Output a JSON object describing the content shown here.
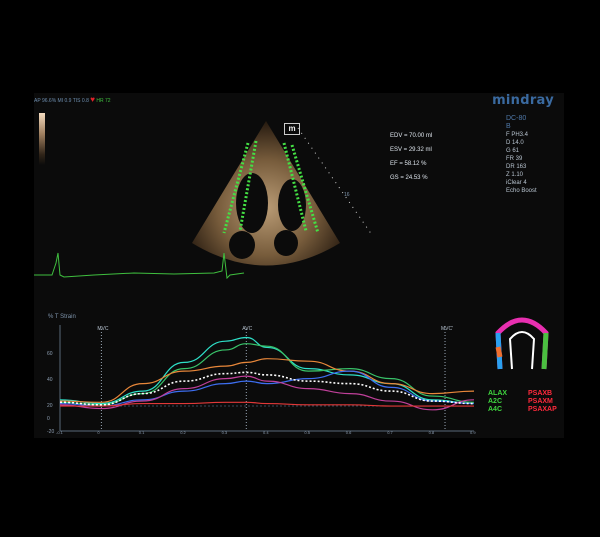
{
  "status_bar": {
    "prefix": "AP 96.6%  MI 0.9 TIS 0.8",
    "hr": "HR 72",
    "heart_icon": "heart-icon"
  },
  "brand": "mindray",
  "params": {
    "model": "DC-80",
    "mode": "B",
    "lines": [
      "F PH3.4",
      "D 14.0",
      "G 61",
      "FR 39",
      "DR 163",
      "Z 1.10",
      "iClear 4",
      "Echo Boost"
    ]
  },
  "metrics": {
    "edv": "EDV = 70.00 ml",
    "esv": "ESV = 29.32 ml",
    "ef": "EF = 58.12 %",
    "gs": "GS = 24.53 %"
  },
  "depth_mark": "16",
  "chart_data": {
    "type": "line",
    "title": "% T Strain",
    "y_ticks": [
      "60",
      "40",
      "20",
      "0",
      "-20"
    ],
    "ylim": [
      -20,
      65
    ],
    "x_ticks": [
      "-0.1",
      "0",
      "0.1",
      "0.2",
      "0.3",
      "0.4",
      "0.5",
      "0.6",
      "0.7",
      "0.8",
      "0.9"
    ],
    "xlim": [
      -0.1,
      0.9
    ],
    "events": [
      {
        "label": "MVC",
        "x": 0.0
      },
      {
        "label": "AVC",
        "x": 0.35
      },
      {
        "label": "MVC'",
        "x": 0.83
      }
    ],
    "series": [
      {
        "color": "#2ee0c8",
        "x": [
          -0.1,
          0,
          0.1,
          0.2,
          0.3,
          0.35,
          0.4,
          0.5,
          0.6,
          0.7,
          0.8,
          0.9
        ],
        "values": [
          5,
          2,
          12,
          35,
          52,
          55,
          47,
          30,
          25,
          18,
          5,
          2
        ]
      },
      {
        "color": "#39c46a",
        "x": [
          -0.1,
          0,
          0.1,
          0.2,
          0.3,
          0.35,
          0.4,
          0.5,
          0.6,
          0.7,
          0.8,
          0.9
        ],
        "values": [
          3,
          1,
          10,
          30,
          45,
          50,
          48,
          28,
          30,
          22,
          8,
          3
        ]
      },
      {
        "color": "#e8873a",
        "x": [
          -0.1,
          0,
          0.1,
          0.2,
          0.3,
          0.35,
          0.4,
          0.5,
          0.6,
          0.7,
          0.8,
          0.9
        ],
        "values": [
          4,
          3,
          18,
          28,
          32,
          35,
          38,
          36,
          28,
          18,
          10,
          12
        ]
      },
      {
        "color": "#3d6ef0",
        "x": [
          -0.1,
          0,
          0.1,
          0.2,
          0.3,
          0.35,
          0.4,
          0.5,
          0.6,
          0.7,
          0.8,
          0.9
        ],
        "values": [
          2,
          0,
          5,
          12,
          18,
          20,
          18,
          22,
          28,
          15,
          4,
          2
        ]
      },
      {
        "color": "#c0409a",
        "x": [
          -0.1,
          0,
          0.1,
          0.2,
          0.3,
          0.35,
          0.4,
          0.5,
          0.6,
          0.7,
          0.8,
          0.9
        ],
        "values": [
          1,
          -2,
          4,
          14,
          22,
          24,
          20,
          14,
          10,
          4,
          -3,
          5
        ]
      },
      {
        "color": "#e23838",
        "x": [
          -0.1,
          0,
          0.1,
          0.2,
          0.3,
          0.35,
          0.4,
          0.5,
          0.6,
          0.7,
          0.8,
          0.9
        ],
        "values": [
          0,
          0,
          2,
          2,
          3,
          3,
          2,
          1,
          1,
          0,
          0,
          0
        ]
      },
      {
        "color": "#ffffff",
        "dashed": true,
        "x": [
          -0.1,
          0,
          0.1,
          0.2,
          0.3,
          0.35,
          0.4,
          0.5,
          0.6,
          0.7,
          0.8,
          0.9
        ],
        "values": [
          3,
          1,
          10,
          20,
          26,
          27,
          25,
          20,
          18,
          12,
          4,
          2
        ]
      }
    ]
  },
  "segment_legend": {
    "left": [
      "ALAX",
      "A2C",
      "A4C"
    ],
    "right": [
      "PSAXB",
      "PSAXM",
      "PSAXAP"
    ]
  }
}
